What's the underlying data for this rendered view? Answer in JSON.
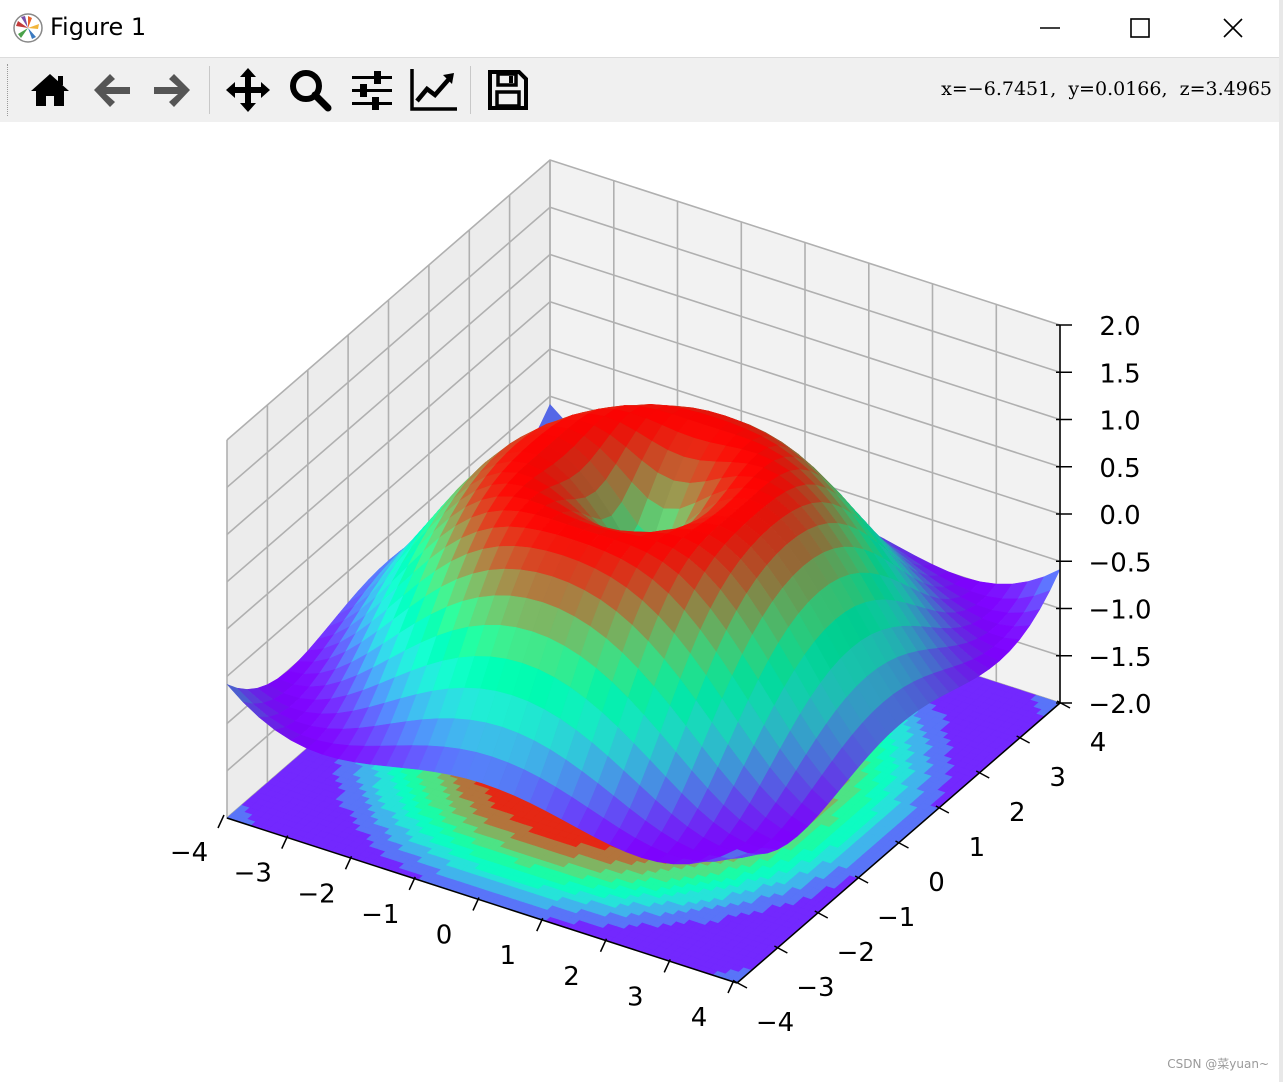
{
  "window": {
    "title": "Figure 1",
    "minimize_icon": "minimize-icon",
    "maximize_icon": "maximize-icon",
    "close_icon": "close-icon"
  },
  "toolbar": {
    "buttons": [
      {
        "name": "home-button",
        "icon": "home-icon"
      },
      {
        "name": "back-button",
        "icon": "arrow-left-icon"
      },
      {
        "name": "forward-button",
        "icon": "arrow-right-icon"
      },
      {
        "name": "pan-button",
        "icon": "move-icon"
      },
      {
        "name": "zoom-button",
        "icon": "search-icon"
      },
      {
        "name": "subplots-button",
        "icon": "sliders-icon"
      },
      {
        "name": "axes-button",
        "icon": "chart-line-icon"
      },
      {
        "name": "save-button",
        "icon": "save-icon"
      }
    ],
    "coords": "x=−6.7451,  y=0.0166,  z=3.4965"
  },
  "chart_data": {
    "type": "surface",
    "title": "",
    "xlabel": "",
    "ylabel": "",
    "zlabel": "",
    "colormap": "rainbow",
    "x_range": [
      -4,
      4
    ],
    "y_range": [
      -4,
      4
    ],
    "zlim": [
      -2,
      2
    ],
    "x_ticks": [
      "−4",
      "−3",
      "−2",
      "−1",
      "0",
      "1",
      "2",
      "3",
      "4"
    ],
    "y_ticks": [
      "−4",
      "−3",
      "−2",
      "−1",
      "0",
      "1",
      "2",
      "3",
      "4"
    ],
    "z_ticks": [
      "2.0",
      "1.5",
      "1.0",
      "0.5",
      "0.0",
      "−0.5",
      "−1.0",
      "−1.5",
      "−2.0"
    ],
    "surface": {
      "function": "sin(sqrt(x^2 + y^2))",
      "grid_step": 0.25
    },
    "contour_offset": -2,
    "grid": true
  },
  "watermark": "CSDN @菜yuan~"
}
